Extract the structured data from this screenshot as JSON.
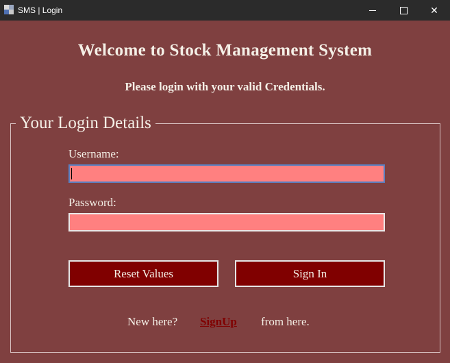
{
  "window": {
    "title": "SMS | Login",
    "controls": {
      "minimize": "minimize-icon",
      "maximize": "maximize-icon",
      "close": "close-icon"
    }
  },
  "header": {
    "title": "Welcome to Stock Management System",
    "subtitle": "Please login with your valid Credentials."
  },
  "login": {
    "group_title": "Your Login Details",
    "username_label": "Username:",
    "username_value": "",
    "password_label": "Password:",
    "password_value": ""
  },
  "actions": {
    "reset_label": "Reset Values",
    "signin_label": "Sign In"
  },
  "footer": {
    "prefix": "New here?",
    "link": "SignUp",
    "suffix": "from here."
  },
  "colors": {
    "background": "#7f4040",
    "input_fill": "#ff8080",
    "button_fill": "#800000",
    "text": "#f4efe6",
    "link": "#800000"
  }
}
